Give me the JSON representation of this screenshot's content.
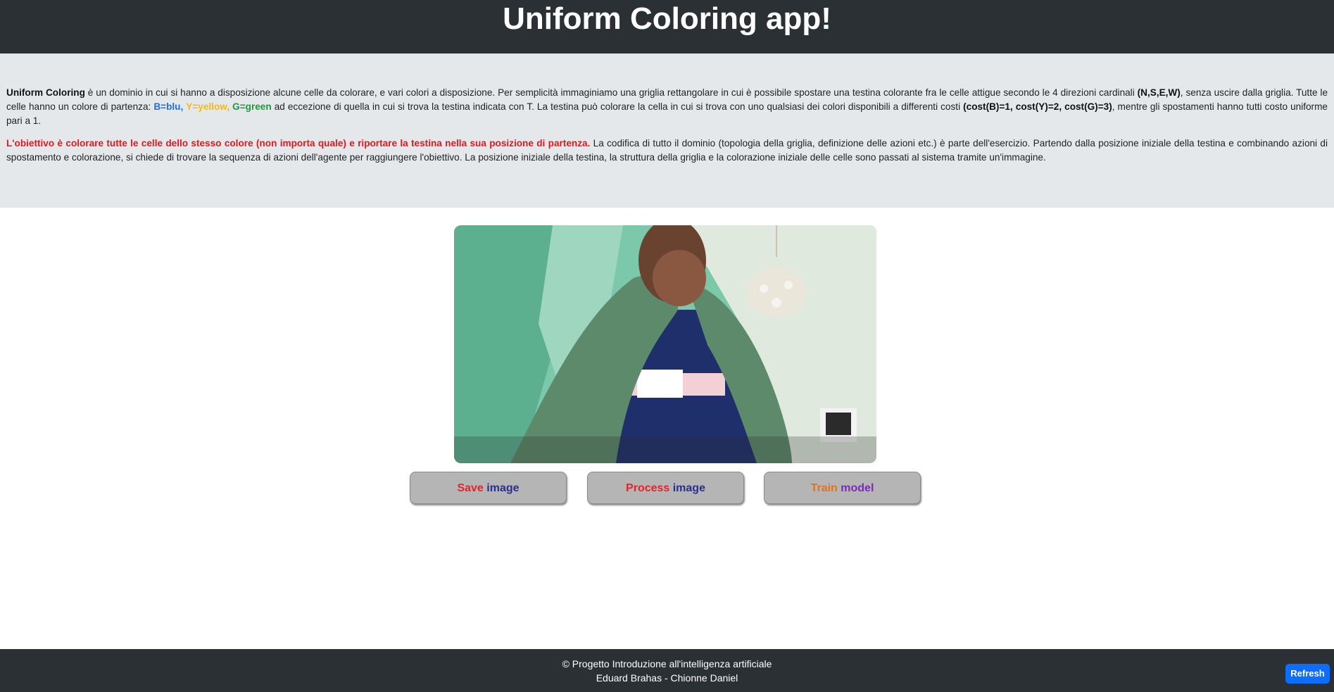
{
  "header": {
    "title": "Uniform Coloring app!"
  },
  "description": {
    "p1": {
      "title_bold": "Uniform Coloring",
      "text_a": " è un dominio in cui si hanno a disposizione alcune celle da colorare, e vari colori a disposizione. Per semplicità immaginiamo una griglia rettangolare in cui è possibile spostare una testina colorante fra le celle attigue secondo le 4 direzioni cardinali ",
      "directions": "(N,S,E,W)",
      "text_b": ", senza uscire dalla griglia. Tutte le celle hanno un colore di partenza: ",
      "blue": "B=blu,",
      "yellow": "Y=yellow,",
      "green": "G=green",
      "text_c": " ad eccezione di quella in cui si trova la testina indicata con T. La testina può colorare la cella in cui si trova con uno qualsiasi dei colori disponibili a differenti costi ",
      "costs": "(cost(B)=1, cost(Y)=2, cost(G)=3)",
      "text_d": ", mentre gli spostamenti hanno tutti costo uniforme pari a 1."
    },
    "p2": {
      "goal": "L'obiettivo è colorare tutte le celle dello stesso colore (non importa quale) e riportare la testina nella sua posizione di partenza.",
      "text": " La codifica di tutto il dominio (topologia della griglia, definizione delle azioni etc.) è parte dell'esercizio. Partendo dalla posizione iniziale della testina e combinando azioni di spostamento e colorazione, si chiede di trovare la sequenza di azioni dell'agente per raggiungere l'obiettivo. La posizione iniziale della testina, la struttura della griglia e la colorazione iniziale delle celle sono passati al sistema tramite un'immagine."
    }
  },
  "buttons": {
    "save": {
      "w1": "Save",
      "w2": "image"
    },
    "process": {
      "w1": "Process",
      "w2": "image"
    },
    "train": {
      "w1": "Train",
      "w2": "model"
    }
  },
  "footer": {
    "line1": "© Progetto Introduzione all'intelligenza artificiale",
    "line2": "Eduard Brahas - Chionne Daniel"
  },
  "refresh_label": "Refresh",
  "colors": {
    "header_bg": "#2b3035",
    "description_bg": "#e4e8eb",
    "button_bg": "#b5b5b5",
    "refresh_bg": "#0d6efd",
    "goal_red": "#e8161b"
  }
}
